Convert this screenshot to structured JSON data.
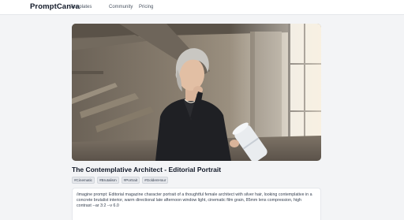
{
  "nav": {
    "brand": "PromptCanva",
    "links": [
      "Templates",
      "Community",
      "Pricing"
    ]
  },
  "hero": {
    "alt_subject": "woman-architect-portrait"
  },
  "card": {
    "title": "The Contemplative Architect - Editorial Portrait",
    "tags": [
      "#Cinematic",
      "#Brutalism",
      "#Portrait",
      "#GoldenHour"
    ],
    "prompt": "/imagine prompt: Editorial magazine character portrait of a thoughtful female architect with silver hair, looking contemplative in a concrete brutalist interior, warm directional late afternoon window light, cinematic film grain, 85mm lens compression, high contrast --ar 3:2 --v 6.0"
  },
  "colors": {
    "page_bg": "#f3f4f6",
    "nav_bg": "#ffffff",
    "accent_text": "#111827"
  }
}
